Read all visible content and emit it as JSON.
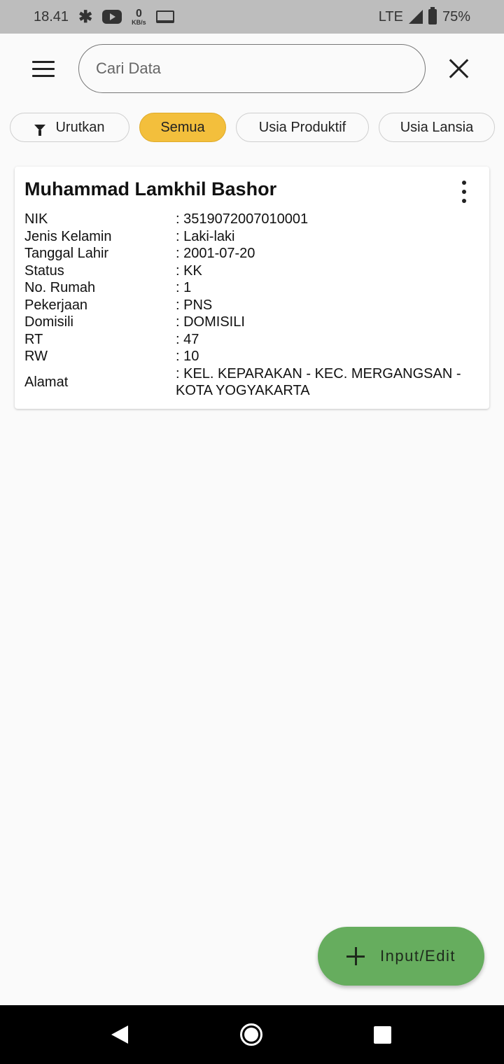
{
  "status_bar": {
    "time": "18.41",
    "kbs_value": "0",
    "kbs_unit": "KB/s",
    "network": "LTE",
    "battery": "75%"
  },
  "search": {
    "placeholder": "Cari Data"
  },
  "filters": {
    "sort_label": "Urutkan",
    "chips": [
      "Semua",
      "Usia Produktif",
      "Usia Lansia"
    ],
    "active": "Semua"
  },
  "record": {
    "name": "Muhammad Lamkhil Bashor",
    "fields": [
      {
        "label": "NIK",
        "value": ": 3519072007010001"
      },
      {
        "label": "Jenis Kelamin",
        "value": ": Laki-laki"
      },
      {
        "label": "Tanggal Lahir",
        "value": ": 2001-07-20"
      },
      {
        "label": "Status",
        "value": ": KK"
      },
      {
        "label": "No. Rumah",
        "value": ": 1"
      },
      {
        "label": "Pekerjaan",
        "value": ": PNS"
      },
      {
        "label": "Domisili",
        "value": ": DOMISILI"
      },
      {
        "label": "RT",
        "value": ": 47"
      },
      {
        "label": "RW",
        "value": ": 10"
      },
      {
        "label": "Alamat",
        "value": ": KEL. KEPARAKAN - KEC. MERGANGSAN - KOTA YOGYAKARTA"
      }
    ]
  },
  "fab": {
    "label": "Input/Edit"
  },
  "colors": {
    "active_chip": "#f3bf3c",
    "fab": "#66ad5e",
    "status_bar": "#bdbdbd",
    "nav_bar": "#000000"
  }
}
